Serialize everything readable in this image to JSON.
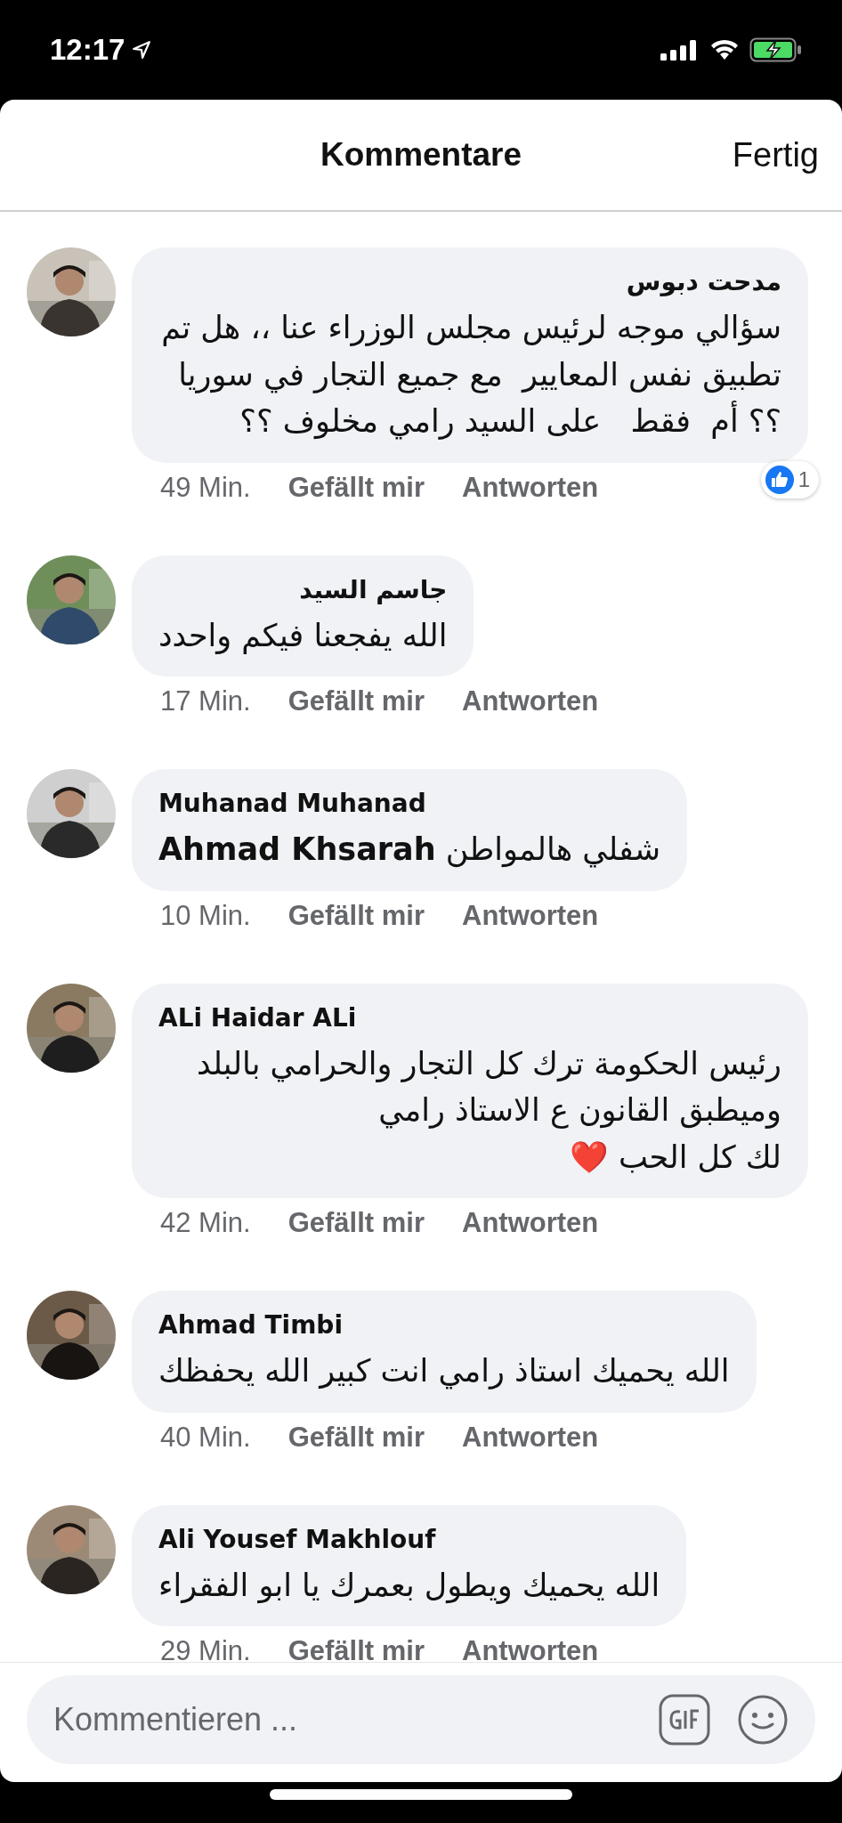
{
  "status_bar": {
    "time": "12:17"
  },
  "header": {
    "title": "Kommentare",
    "done": "Fertig"
  },
  "comments": [
    {
      "author": "مدحت دبوس",
      "text": "سؤالي موجه لرئيس مجلس الوزراء عنا ،، هل تم تطبيق نفس المعايير  مع جميع التجار في سوريا ؟؟ أم  فقط   على السيد رامي مخلوف ؟؟",
      "time": "49 Min.",
      "like": "Gefällt mir",
      "reply": "Antworten",
      "reactions": "1"
    },
    {
      "author": "جاسم السيد",
      "text": "الله يفجعنا فيكم واحدد",
      "time": "17 Min.",
      "like": "Gefällt mir",
      "reply": "Antworten"
    },
    {
      "author": "Muhanad Muhanad",
      "text": "**Ahmad Khsarah** شفلي هالمواطن",
      "time": "10 Min.",
      "like": "Gefällt mir",
      "reply": "Antworten"
    },
    {
      "author": "ALi Haidar ALi",
      "text": "رئيس الحكومة ترك كل التجار والحرامي بالبلد وميطبق القانون ع الاستاذ رامي\nلك كل الحب ❤️",
      "time": "42 Min.",
      "like": "Gefällt mir",
      "reply": "Antworten"
    },
    {
      "author": "Ahmad Timbi",
      "text": "الله يحميك استاذ رامي انت كبير الله يحفظك",
      "time": "40 Min.",
      "like": "Gefällt mir",
      "reply": "Antworten"
    },
    {
      "author": "Ali Yousef Makhlouf",
      "text": "الله يحميك ويطول بعمرك يا ابو الفقراء",
      "time": "29 Min.",
      "like": "Gefällt mir",
      "reply": "Antworten"
    }
  ],
  "composer": {
    "placeholder": "Kommentieren ..."
  }
}
